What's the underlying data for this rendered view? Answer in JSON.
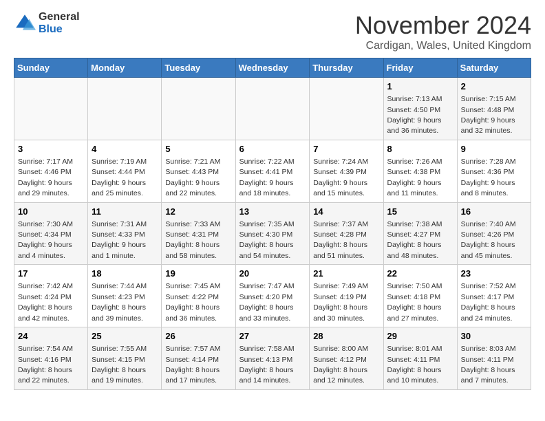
{
  "header": {
    "logo_general": "General",
    "logo_blue": "Blue",
    "month": "November 2024",
    "location": "Cardigan, Wales, United Kingdom"
  },
  "weekdays": [
    "Sunday",
    "Monday",
    "Tuesday",
    "Wednesday",
    "Thursday",
    "Friday",
    "Saturday"
  ],
  "weeks": [
    [
      {
        "day": "",
        "info": ""
      },
      {
        "day": "",
        "info": ""
      },
      {
        "day": "",
        "info": ""
      },
      {
        "day": "",
        "info": ""
      },
      {
        "day": "",
        "info": ""
      },
      {
        "day": "1",
        "info": "Sunrise: 7:13 AM\nSunset: 4:50 PM\nDaylight: 9 hours and 36 minutes."
      },
      {
        "day": "2",
        "info": "Sunrise: 7:15 AM\nSunset: 4:48 PM\nDaylight: 9 hours and 32 minutes."
      }
    ],
    [
      {
        "day": "3",
        "info": "Sunrise: 7:17 AM\nSunset: 4:46 PM\nDaylight: 9 hours and 29 minutes."
      },
      {
        "day": "4",
        "info": "Sunrise: 7:19 AM\nSunset: 4:44 PM\nDaylight: 9 hours and 25 minutes."
      },
      {
        "day": "5",
        "info": "Sunrise: 7:21 AM\nSunset: 4:43 PM\nDaylight: 9 hours and 22 minutes."
      },
      {
        "day": "6",
        "info": "Sunrise: 7:22 AM\nSunset: 4:41 PM\nDaylight: 9 hours and 18 minutes."
      },
      {
        "day": "7",
        "info": "Sunrise: 7:24 AM\nSunset: 4:39 PM\nDaylight: 9 hours and 15 minutes."
      },
      {
        "day": "8",
        "info": "Sunrise: 7:26 AM\nSunset: 4:38 PM\nDaylight: 9 hours and 11 minutes."
      },
      {
        "day": "9",
        "info": "Sunrise: 7:28 AM\nSunset: 4:36 PM\nDaylight: 9 hours and 8 minutes."
      }
    ],
    [
      {
        "day": "10",
        "info": "Sunrise: 7:30 AM\nSunset: 4:34 PM\nDaylight: 9 hours and 4 minutes."
      },
      {
        "day": "11",
        "info": "Sunrise: 7:31 AM\nSunset: 4:33 PM\nDaylight: 9 hours and 1 minute."
      },
      {
        "day": "12",
        "info": "Sunrise: 7:33 AM\nSunset: 4:31 PM\nDaylight: 8 hours and 58 minutes."
      },
      {
        "day": "13",
        "info": "Sunrise: 7:35 AM\nSunset: 4:30 PM\nDaylight: 8 hours and 54 minutes."
      },
      {
        "day": "14",
        "info": "Sunrise: 7:37 AM\nSunset: 4:28 PM\nDaylight: 8 hours and 51 minutes."
      },
      {
        "day": "15",
        "info": "Sunrise: 7:38 AM\nSunset: 4:27 PM\nDaylight: 8 hours and 48 minutes."
      },
      {
        "day": "16",
        "info": "Sunrise: 7:40 AM\nSunset: 4:26 PM\nDaylight: 8 hours and 45 minutes."
      }
    ],
    [
      {
        "day": "17",
        "info": "Sunrise: 7:42 AM\nSunset: 4:24 PM\nDaylight: 8 hours and 42 minutes."
      },
      {
        "day": "18",
        "info": "Sunrise: 7:44 AM\nSunset: 4:23 PM\nDaylight: 8 hours and 39 minutes."
      },
      {
        "day": "19",
        "info": "Sunrise: 7:45 AM\nSunset: 4:22 PM\nDaylight: 8 hours and 36 minutes."
      },
      {
        "day": "20",
        "info": "Sunrise: 7:47 AM\nSunset: 4:20 PM\nDaylight: 8 hours and 33 minutes."
      },
      {
        "day": "21",
        "info": "Sunrise: 7:49 AM\nSunset: 4:19 PM\nDaylight: 8 hours and 30 minutes."
      },
      {
        "day": "22",
        "info": "Sunrise: 7:50 AM\nSunset: 4:18 PM\nDaylight: 8 hours and 27 minutes."
      },
      {
        "day": "23",
        "info": "Sunrise: 7:52 AM\nSunset: 4:17 PM\nDaylight: 8 hours and 24 minutes."
      }
    ],
    [
      {
        "day": "24",
        "info": "Sunrise: 7:54 AM\nSunset: 4:16 PM\nDaylight: 8 hours and 22 minutes."
      },
      {
        "day": "25",
        "info": "Sunrise: 7:55 AM\nSunset: 4:15 PM\nDaylight: 8 hours and 19 minutes."
      },
      {
        "day": "26",
        "info": "Sunrise: 7:57 AM\nSunset: 4:14 PM\nDaylight: 8 hours and 17 minutes."
      },
      {
        "day": "27",
        "info": "Sunrise: 7:58 AM\nSunset: 4:13 PM\nDaylight: 8 hours and 14 minutes."
      },
      {
        "day": "28",
        "info": "Sunrise: 8:00 AM\nSunset: 4:12 PM\nDaylight: 8 hours and 12 minutes."
      },
      {
        "day": "29",
        "info": "Sunrise: 8:01 AM\nSunset: 4:11 PM\nDaylight: 8 hours and 10 minutes."
      },
      {
        "day": "30",
        "info": "Sunrise: 8:03 AM\nSunset: 4:11 PM\nDaylight: 8 hours and 7 minutes."
      }
    ]
  ]
}
